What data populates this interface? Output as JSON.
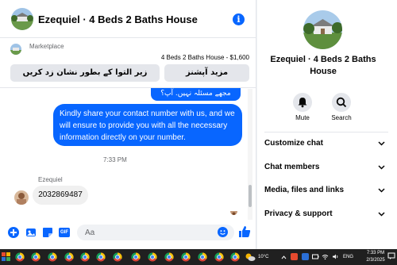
{
  "header": {
    "title": "Ezequiel · 4 Beds 2 Baths House"
  },
  "marketplace": {
    "label": "Marketplace",
    "listing": "4 Beds 2 Baths House - $1,600",
    "buttons": [
      {
        "label": "زیر التوا کے بطور نشان زد کریں"
      },
      {
        "label": "مزید آپشنز"
      }
    ]
  },
  "messages": {
    "outgoing_top": "مجھے مسئلہ نہیں. آپ؟",
    "outgoing": "Kindly share your contact number with us, and we will ensure to provide you with all the necessary information directly on your number.",
    "time": "7:33 PM",
    "sender": "Ezequiel",
    "incoming": "2032869487"
  },
  "composer": {
    "placeholder": "Aa",
    "gif_label": "GIF"
  },
  "panel": {
    "title": "Ezequiel · 4 Beds 2 Baths House",
    "mute_label": "Mute",
    "search_label": "Search",
    "rows": [
      {
        "label": "Customize chat"
      },
      {
        "label": "Chat members"
      },
      {
        "label": "Media, files and links"
      },
      {
        "label": "Privacy & support"
      }
    ]
  },
  "taskbar": {
    "weather": "10°C",
    "language": "ENG",
    "time": "7:33 PM",
    "date": "2/3/2025"
  },
  "colors": {
    "accent": "#0866ff",
    "chat_bg": "#ffffff",
    "bubble_in": "#f0f0f0",
    "taskbar": "#202020"
  }
}
